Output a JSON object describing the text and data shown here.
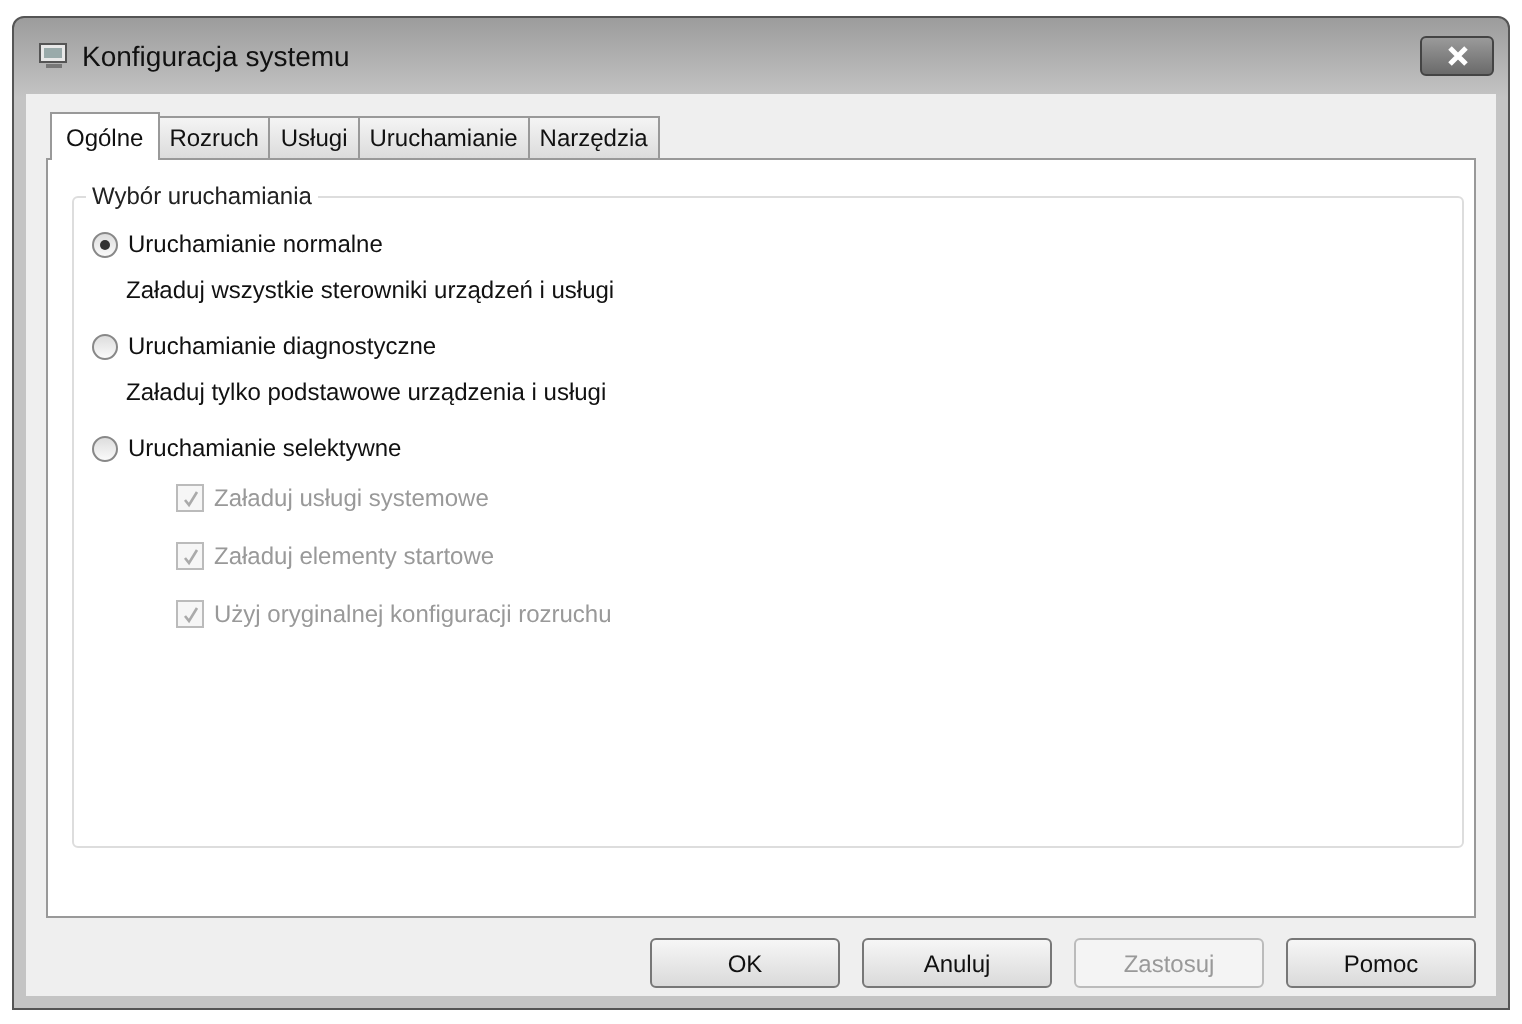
{
  "window": {
    "title": "Konfiguracja systemu"
  },
  "tabs": [
    {
      "label": "Ogólne",
      "selected": true
    },
    {
      "label": "Rozruch",
      "selected": false
    },
    {
      "label": "Usługi",
      "selected": false
    },
    {
      "label": "Uruchamianie",
      "selected": false
    },
    {
      "label": "Narzędzia",
      "selected": false
    }
  ],
  "group": {
    "title": "Wybór uruchamiania",
    "options": [
      {
        "label": "Uruchamianie normalne",
        "selected": true,
        "description": "Załaduj wszystkie sterowniki urządzeń i usługi"
      },
      {
        "label": "Uruchamianie diagnostyczne",
        "selected": false,
        "description": "Załaduj tylko podstawowe urządzenia i usługi"
      },
      {
        "label": "Uruchamianie selektywne",
        "selected": false,
        "suboptions": [
          {
            "label": "Załaduj usługi systemowe",
            "checked": true,
            "disabled": true
          },
          {
            "label": "Załaduj elementy startowe",
            "checked": true,
            "disabled": true
          },
          {
            "label": "Użyj oryginalnej konfiguracji rozruchu",
            "checked": true,
            "disabled": true
          }
        ]
      }
    ]
  },
  "buttons": [
    {
      "label": "OK",
      "disabled": false
    },
    {
      "label": "Anuluj",
      "disabled": false
    },
    {
      "label": "Zastosuj",
      "disabled": true
    },
    {
      "label": "Pomoc",
      "disabled": false
    }
  ]
}
